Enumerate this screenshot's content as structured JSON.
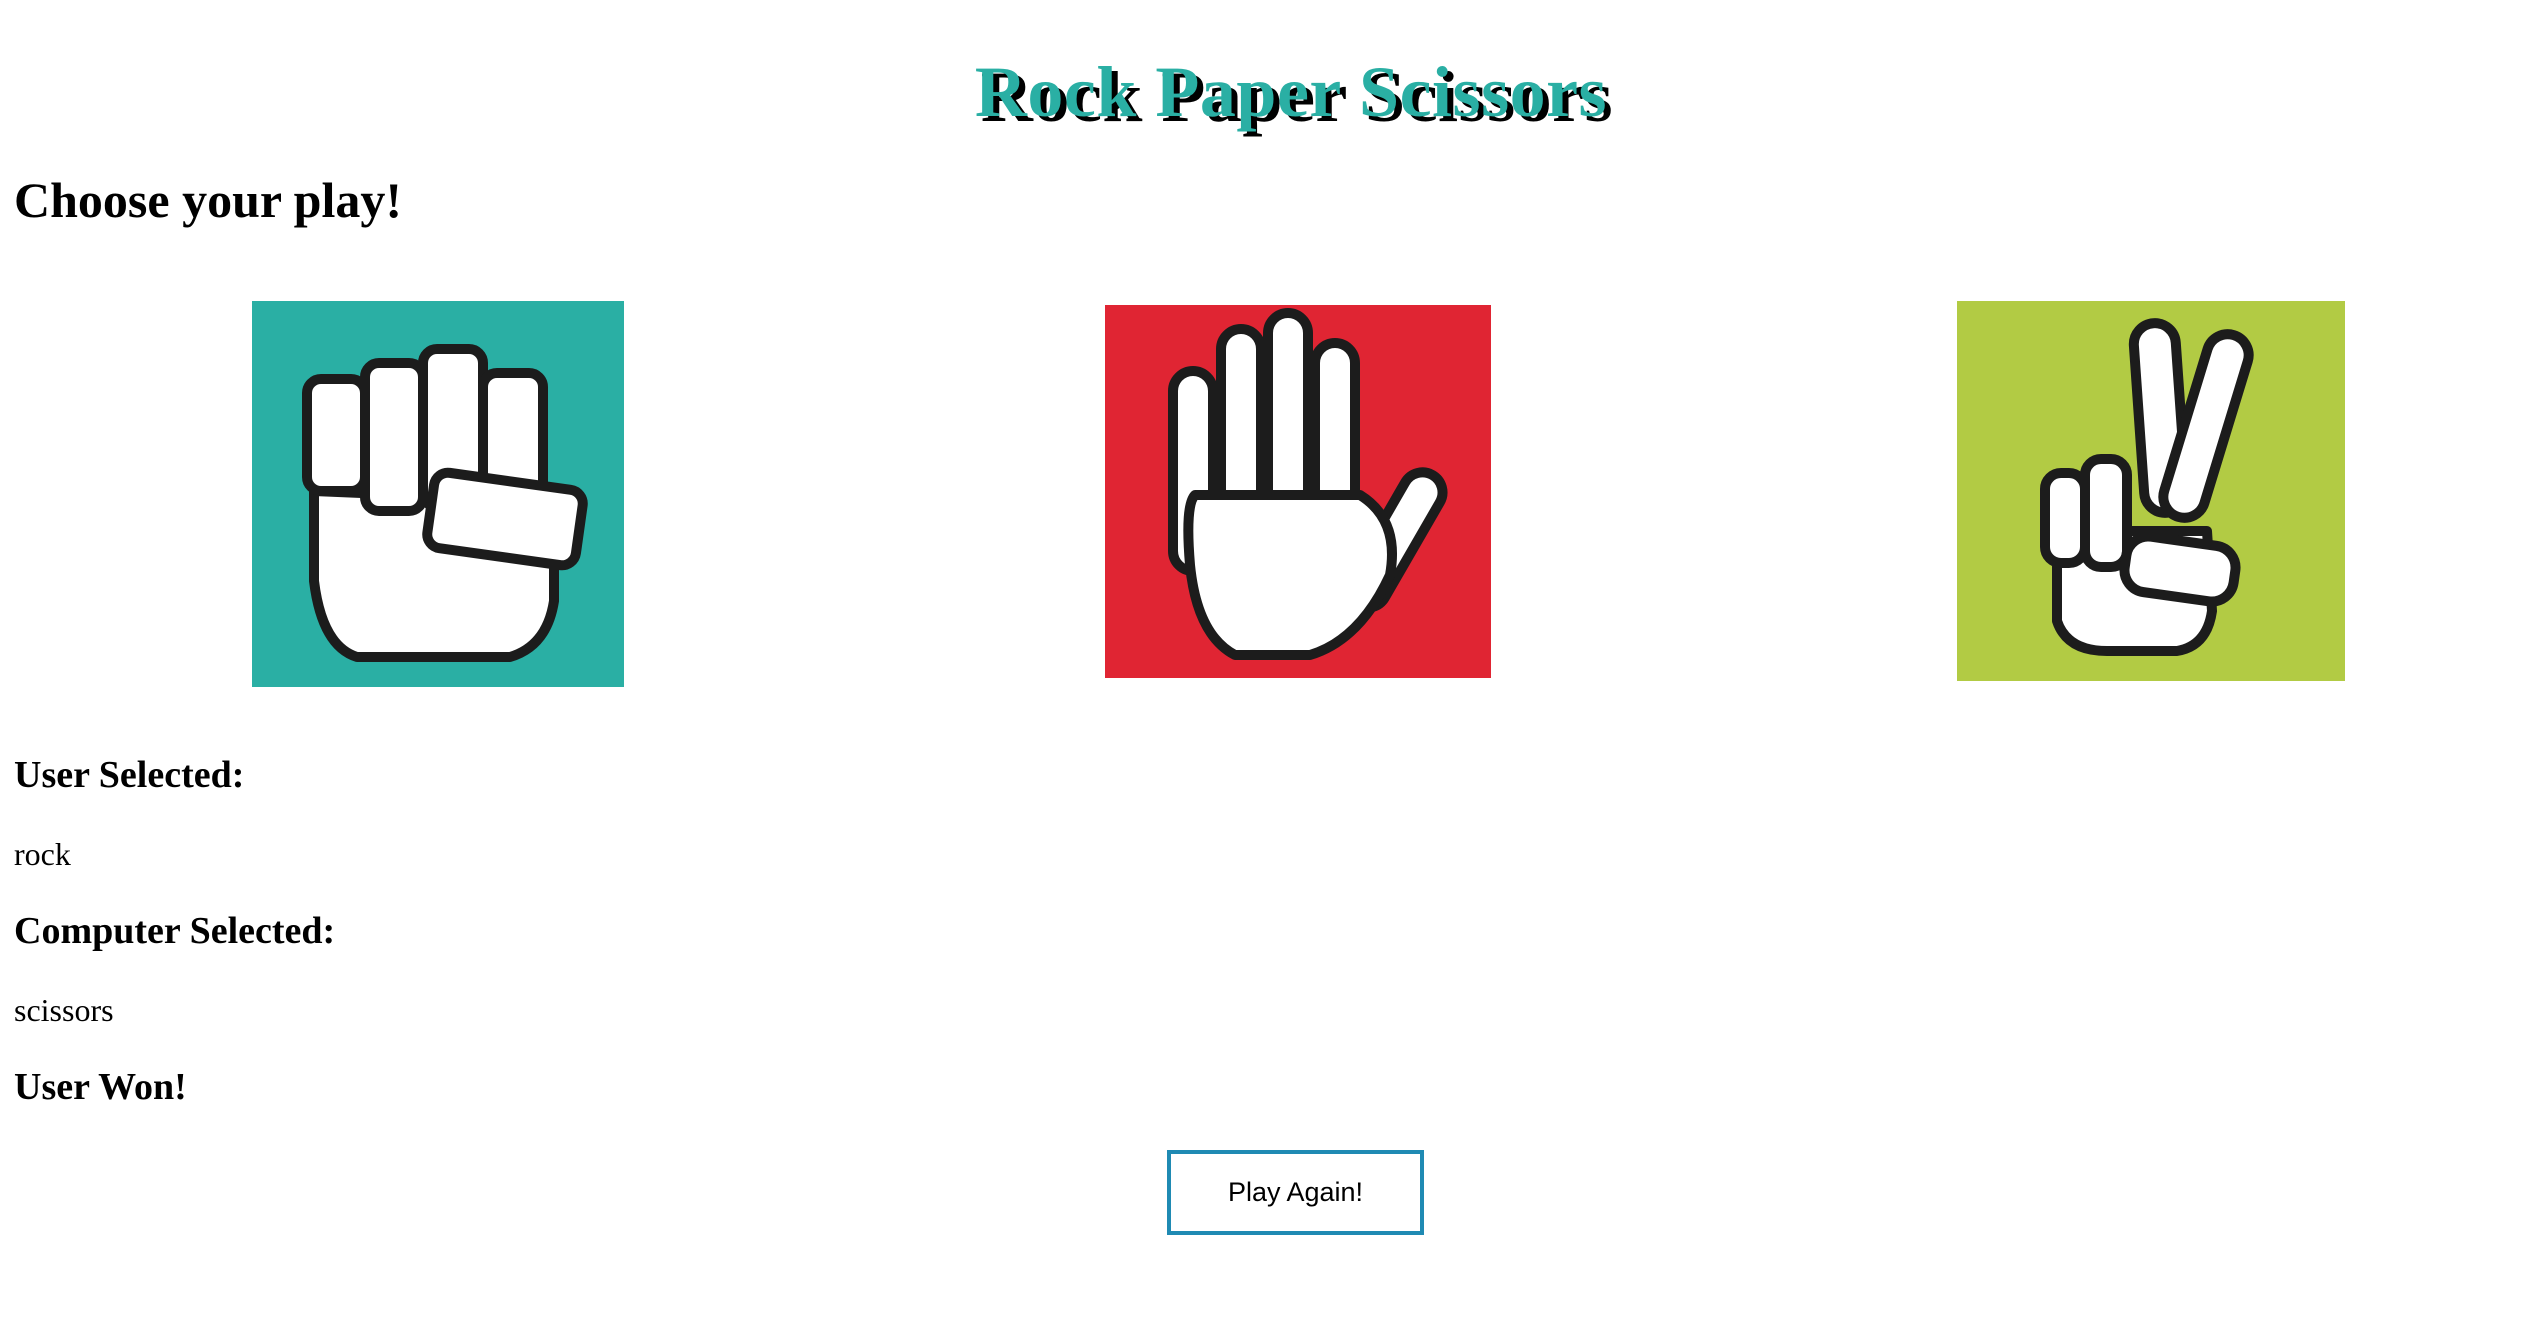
{
  "title": "Rock Paper Scissors",
  "subtitle": "Choose your play!",
  "choices": [
    {
      "name": "rock",
      "icon": "rock-fist-icon",
      "color": "#2aafa4"
    },
    {
      "name": "paper",
      "icon": "paper-hand-icon",
      "color": "#e02533"
    },
    {
      "name": "scissors",
      "icon": "scissors-peace-icon",
      "color": "#b2cb44"
    }
  ],
  "user_selected": {
    "label": "User Selected:",
    "value": "rock"
  },
  "computer_selected": {
    "label": "Computer Selected:",
    "value": "scissors"
  },
  "result": "User Won!",
  "play_again_label": "Play Again!",
  "colors": {
    "title": "#2aafa4",
    "title_shadow": "#000000",
    "button_border": "#1f8ab3"
  }
}
